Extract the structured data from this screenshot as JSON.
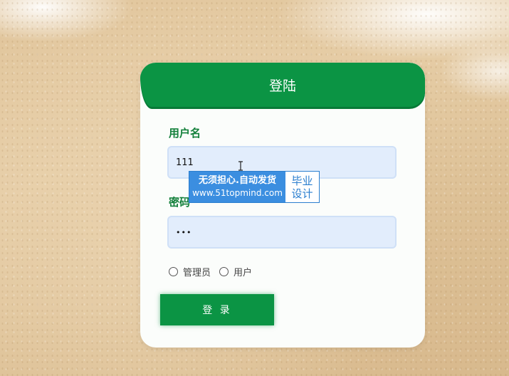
{
  "login_form": {
    "title": "登陆",
    "username_label": "用户名",
    "username_value": "111",
    "password_label": "密码",
    "password_value": "•••",
    "roles": [
      "管理员",
      "用户"
    ],
    "submit_label": "登 录"
  },
  "watermark": {
    "line1": "无须担心.自动发货",
    "line2": "www.51topmind.com",
    "badge_line1": "毕业",
    "badge_line2": "设计"
  },
  "colors": {
    "primary_green": "#0b9444",
    "label_green": "#13803b",
    "input_bg": "#e2edfc",
    "watermark_blue": "#3b8ee0"
  },
  "icons": {
    "cursor": "text-cursor-icon"
  }
}
